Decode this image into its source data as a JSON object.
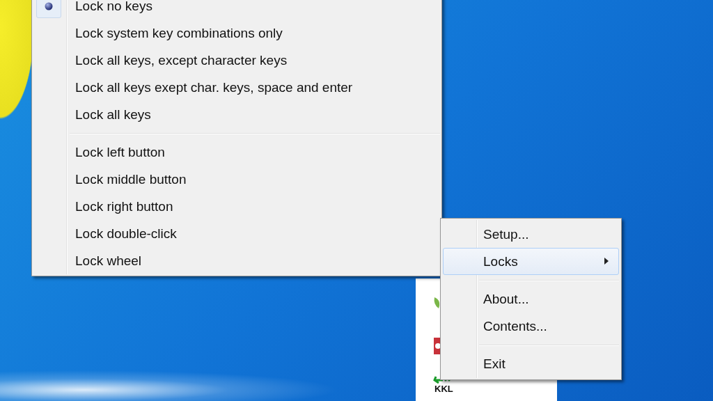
{
  "locks_submenu": {
    "sections": [
      {
        "items": [
          {
            "label": "Lock no keys",
            "selected": true
          },
          {
            "label": "Lock system key combinations only",
            "selected": false
          },
          {
            "label": "Lock all keys, except character keys",
            "selected": false
          },
          {
            "label": "Lock all keys exept char. keys, space and enter",
            "selected": false
          },
          {
            "label": "Lock all keys",
            "selected": false
          }
        ]
      },
      {
        "items": [
          {
            "label": "Lock left button"
          },
          {
            "label": "Lock middle button"
          },
          {
            "label": "Lock right button"
          },
          {
            "label": "Lock double-click"
          },
          {
            "label": "Lock wheel"
          }
        ]
      }
    ]
  },
  "tray_menu": {
    "sections": [
      {
        "items": [
          {
            "label": "Setup...",
            "highlighted": false,
            "has_submenu": false
          },
          {
            "label": "Locks",
            "highlighted": true,
            "has_submenu": true
          }
        ]
      },
      {
        "items": [
          {
            "label": "About...",
            "highlighted": false,
            "has_submenu": false
          },
          {
            "label": "Contents...",
            "highlighted": false,
            "has_submenu": false
          }
        ]
      },
      {
        "items": [
          {
            "label": "Exit",
            "highlighted": false,
            "has_submenu": false
          }
        ]
      }
    ]
  },
  "tray_panel": {
    "icon_label": "KKL"
  }
}
